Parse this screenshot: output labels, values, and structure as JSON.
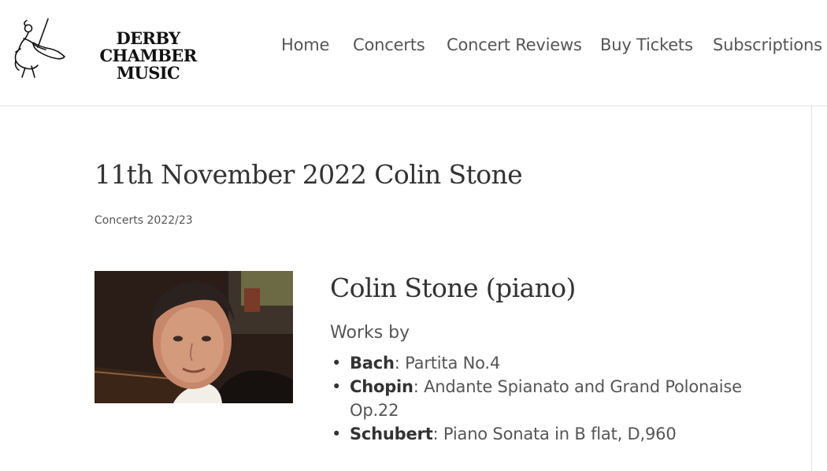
{
  "header": {
    "logo": {
      "line1": "DERBY CHAMBER",
      "line2": "MUSIC",
      "icon": "violinist-icon"
    },
    "nav": [
      {
        "label": "Home"
      },
      {
        "label": "Concerts"
      },
      {
        "label": "Concert Reviews"
      },
      {
        "label": "Buy Tickets"
      },
      {
        "label": "Subscriptions"
      }
    ]
  },
  "article": {
    "title": "11th November 2022 Colin Stone",
    "category": "Concerts 2022/23",
    "performer": "Colin Stone (piano)",
    "works_label": "Works by",
    "works": [
      {
        "bullet": "•",
        "composer": "Bach",
        "piece": ": Partita No.4"
      },
      {
        "bullet": "•",
        "composer": "Chopin",
        "piece": ": Andante Spianato and Grand Polonaise Op.22"
      },
      {
        "bullet": "•",
        "composer": "Schubert",
        "piece": ": Piano Sonata in B flat, D,960"
      }
    ]
  },
  "colors": {
    "text": "#333333",
    "nav": "#555555",
    "divider": "#e2e2e2"
  }
}
